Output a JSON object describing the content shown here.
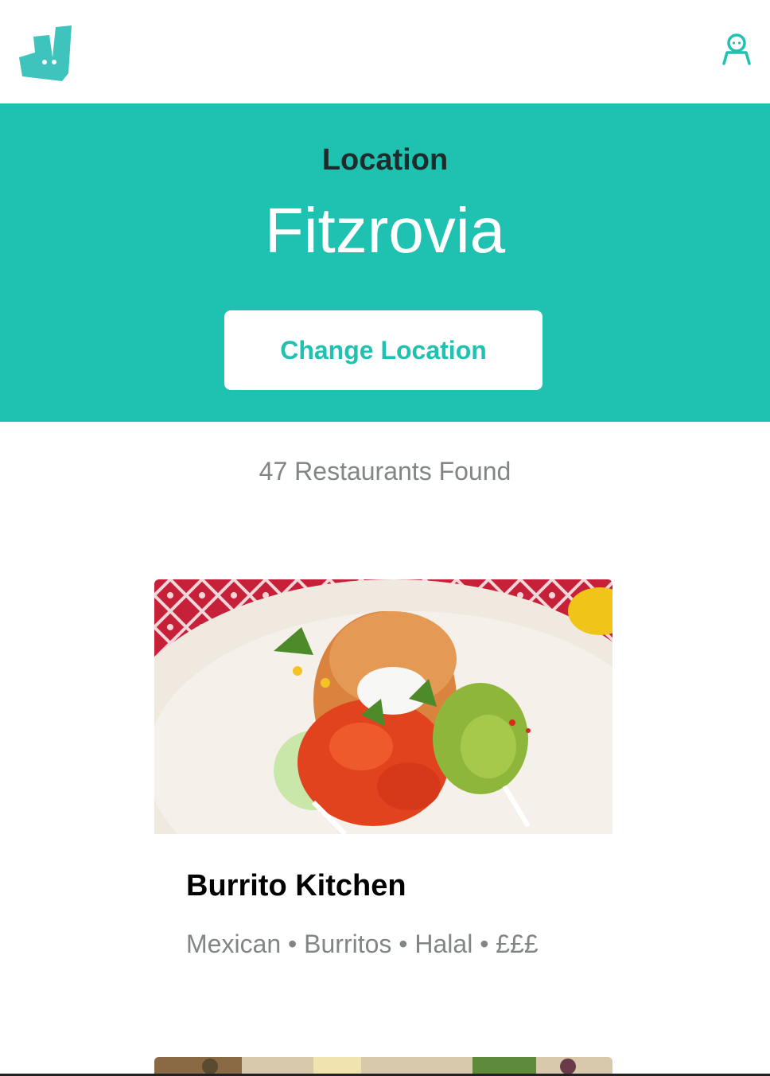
{
  "header": {
    "logo_icon": "deliveroo-kangaroo-logo",
    "account_icon": "user-account-icon",
    "brand_color": "#1fc1b0"
  },
  "hero": {
    "label": "Location",
    "location": "Fitzrovia",
    "change_button": "Change Location",
    "background_color": "#1fc1b0"
  },
  "results": {
    "count_text": "47 Restaurants Found",
    "restaurants": [
      {
        "name": "Burrito Kitchen",
        "meta": "Mexican • Burritos • Halal • £££",
        "image": "burrito-photo"
      },
      {
        "image": "food-photo"
      }
    ]
  }
}
